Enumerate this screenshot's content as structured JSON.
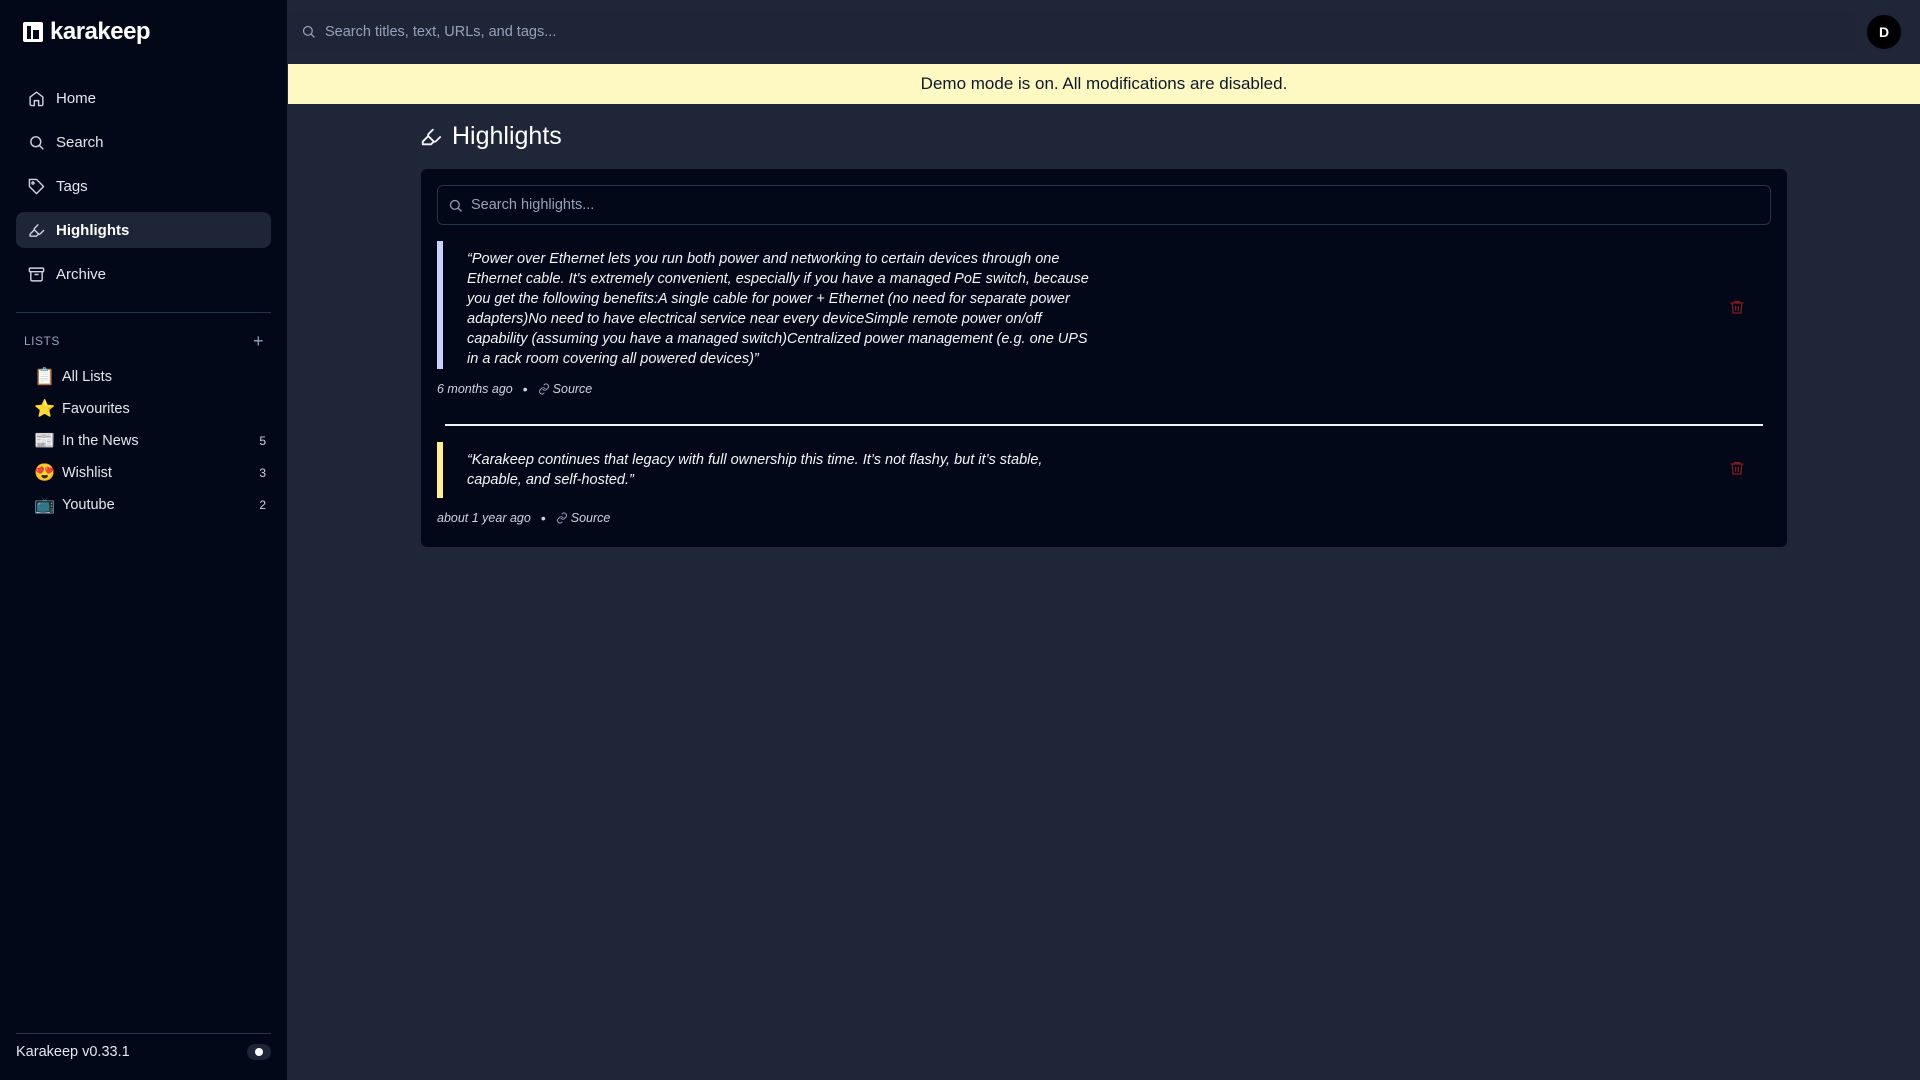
{
  "app": {
    "name": "karakeep",
    "version": "Karakeep v0.33.1"
  },
  "search": {
    "placeholder": "Search titles, text, URLs, and tags..."
  },
  "user": {
    "initial": "D"
  },
  "banner": {
    "text": "Demo mode is on. All modifications are disabled."
  },
  "sidebar": {
    "nav": [
      {
        "label": "Home",
        "icon": "home-icon"
      },
      {
        "label": "Search",
        "icon": "search-icon"
      },
      {
        "label": "Tags",
        "icon": "tag-icon"
      },
      {
        "label": "Highlights",
        "icon": "highlighter-icon",
        "active": true
      },
      {
        "label": "Archive",
        "icon": "archive-icon"
      }
    ],
    "lists_header": "LISTS",
    "add_symbol": "+",
    "lists": [
      {
        "emoji": "📋",
        "label": "All Lists",
        "count": ""
      },
      {
        "emoji": "⭐",
        "label": "Favourites",
        "count": ""
      },
      {
        "emoji": "📰",
        "label": "In the News",
        "count": "5"
      },
      {
        "emoji": "😍",
        "label": "Wishlist",
        "count": "3"
      },
      {
        "emoji": "📺",
        "label": "Youtube",
        "count": "2"
      }
    ]
  },
  "page": {
    "title": "Highlights",
    "search_placeholder": "Search highlights..."
  },
  "highlights": [
    {
      "text": "“Power over Ethernet lets you run both power and networking to certain devices through one Ethernet cable. It's extremely convenient, especially if you have a managed PoE switch, because you get the following benefits:A single cable for power + Ethernet (no need for separate power adapters)No need to have electrical service near every deviceSimple remote power on/off capability (assuming you have a managed switch)Centralized power management (e.g. one UPS in a rack room covering all powered devices)”",
      "time": "6 months ago",
      "source": "Source",
      "color": "#c7d2fe"
    },
    {
      "text": "“Karakeep continues that legacy with full ownership this time. It’s not flashy, but it’s stable, capable, and self-hosted.”",
      "time": "about 1 year ago",
      "source": "Source",
      "color": "#fef08a"
    }
  ],
  "meta_separator": "•"
}
